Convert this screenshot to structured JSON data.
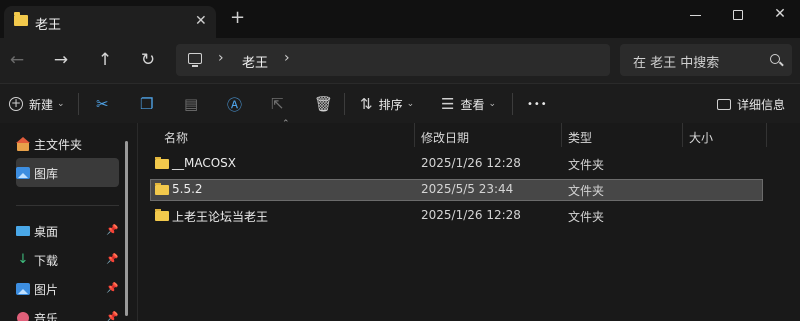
{
  "window": {
    "tab_title": "老王",
    "tab_close": "✕",
    "new_tab": "+",
    "close": "✕"
  },
  "nav": {
    "back": "←",
    "forward": "→",
    "up": "↑",
    "refresh": "↻",
    "breadcrumb_sep": "›",
    "crumb": "老王",
    "search_placeholder": "在 老王 中搜索"
  },
  "toolbar": {
    "new_label": "新建",
    "sort_label": "排序",
    "view_label": "查看",
    "more": "•••",
    "details_label": "详细信息"
  },
  "sidebar": {
    "items": [
      {
        "label": "主文件夹",
        "icon": "home-icon"
      },
      {
        "label": "图库",
        "icon": "gallery-icon"
      },
      {
        "label": "桌面",
        "icon": "desktop-icon",
        "pinned": true
      },
      {
        "label": "下载",
        "icon": "download-icon",
        "pinned": true
      },
      {
        "label": "图片",
        "icon": "pictures-icon",
        "pinned": true
      },
      {
        "label": "音乐",
        "icon": "music-icon",
        "pinned": true
      }
    ]
  },
  "columns": {
    "name": "名称",
    "modified": "修改日期",
    "type": "类型",
    "size": "大小"
  },
  "files": [
    {
      "name": "__MACOSX",
      "modified": "2025/1/26 12:28",
      "type": "文件夹",
      "selected": false
    },
    {
      "name": "5.5.2",
      "modified": "2025/5/5 23:44",
      "type": "文件夹",
      "selected": true
    },
    {
      "name": "上老王论坛当老王",
      "modified": "2025/1/26 12:28",
      "type": "文件夹",
      "selected": false
    }
  ]
}
